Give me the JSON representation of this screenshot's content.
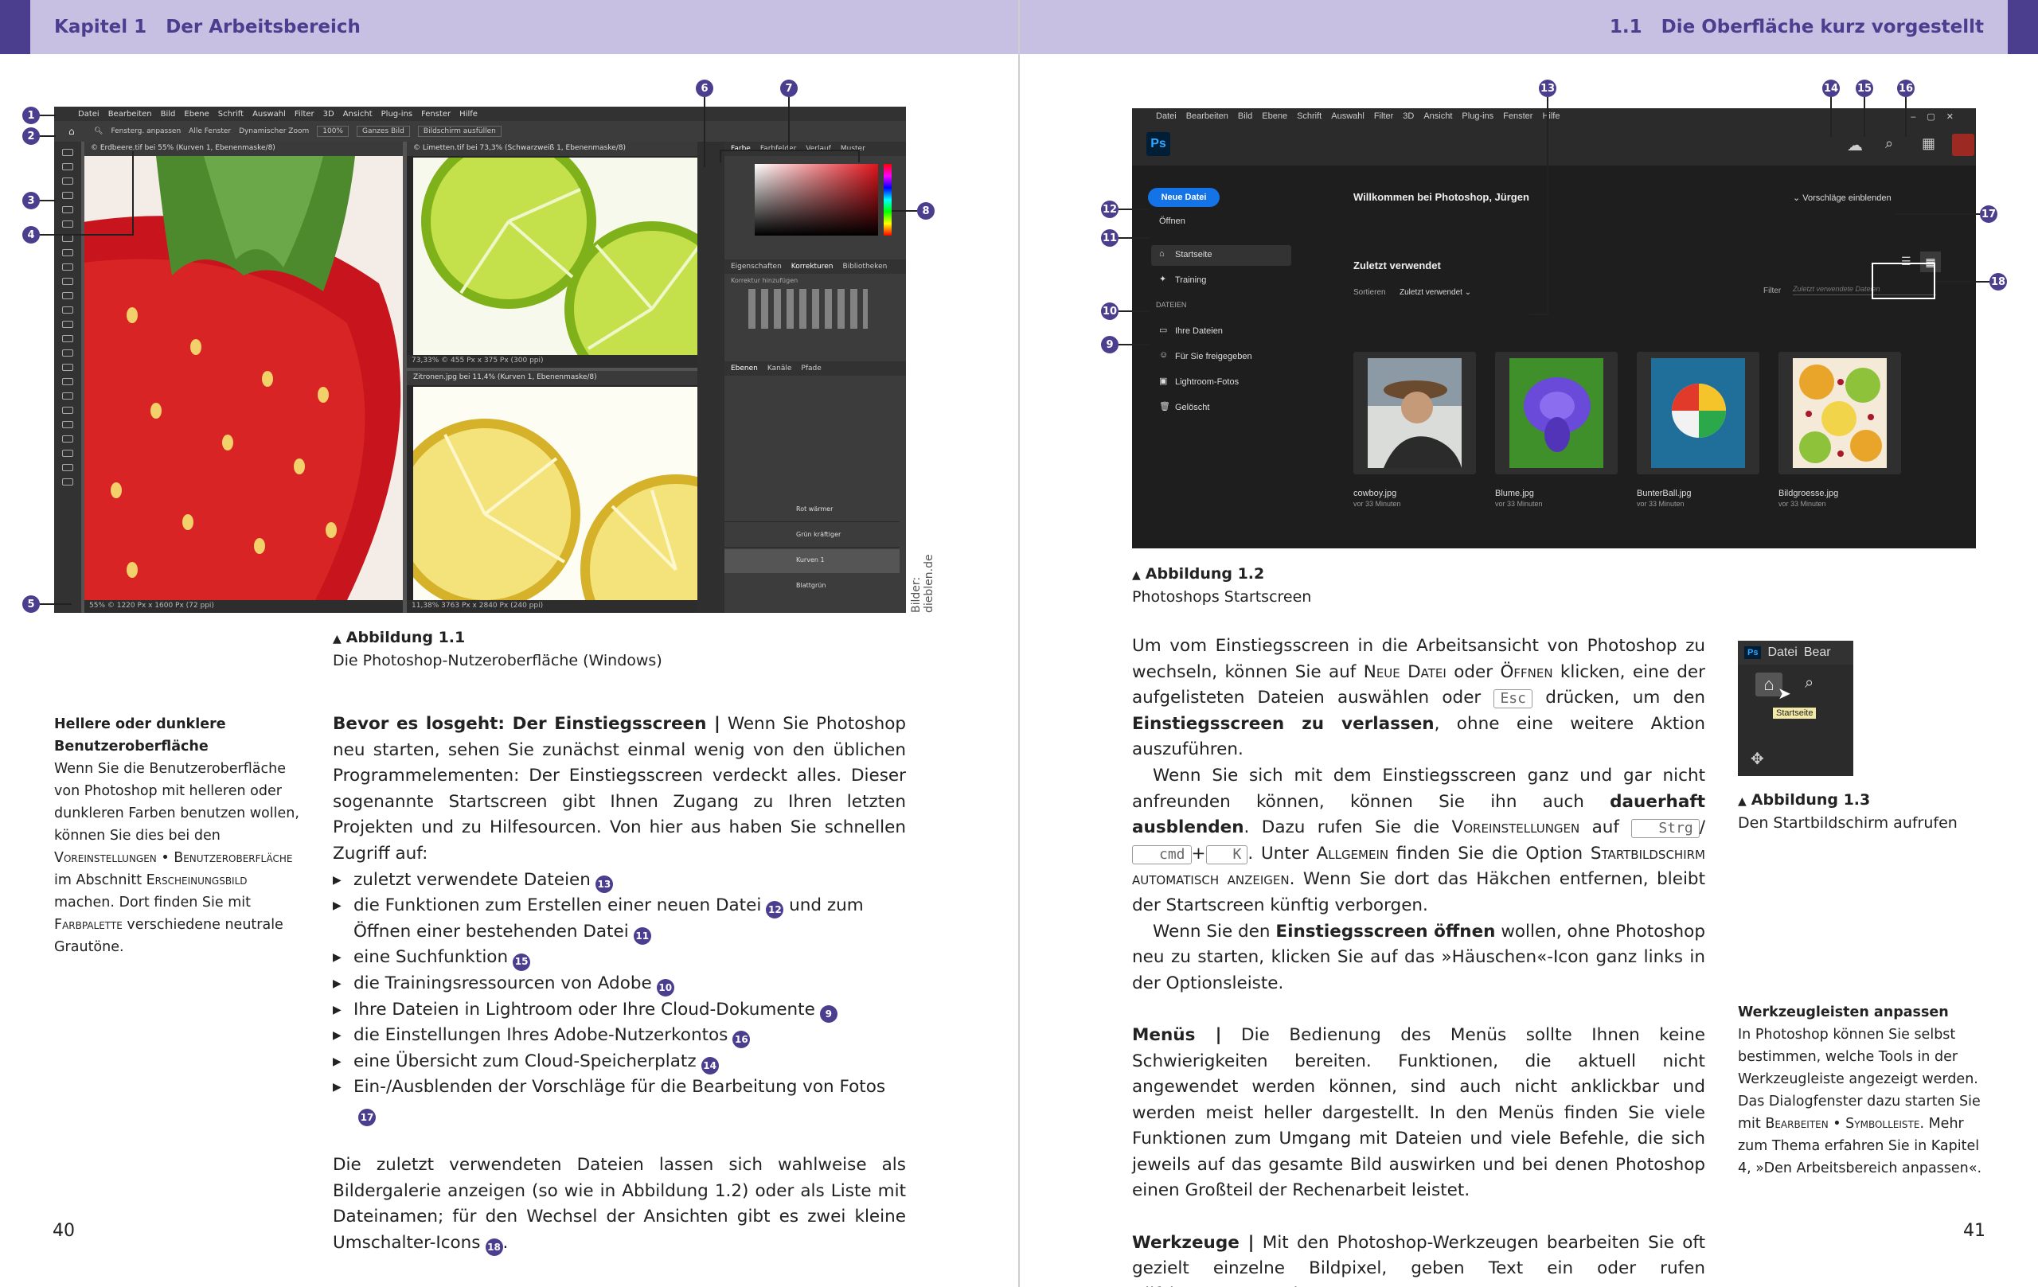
{
  "left": {
    "header_num": "Kapitel 1",
    "header_title": "Der Arbeitsbereich",
    "page_number": "40",
    "figure1": {
      "label": "Abbildung 1.1",
      "caption": "Die Photoshop-Nutzeroberfläche (Windows)",
      "credit": "Bilder: dieblen.de",
      "menu": [
        "Datei",
        "Bearbeiten",
        "Bild",
        "Ebene",
        "Schrift",
        "Auswahl",
        "Filter",
        "3D",
        "Ansicht",
        "Plug-ins",
        "Fenster",
        "Hilfe"
      ],
      "options": [
        "Fensterg. anpassen",
        "Alle Fenster",
        "Dynamischer Zoom",
        "100%",
        "Ganzes Bild",
        "Bildschirm ausfüllen"
      ],
      "doc1_tab": "© Erdbeere.tif bei 55% (Kurven 1, Ebenenmaske/8)",
      "doc1_status": "55%   © 1220 Px x 1600 Px (72 ppi)",
      "doc2_tab": "© Limetten.tif bei 73,3% (Schwarzweiß 1, Ebenenmaske/8)",
      "doc2_status": "73,33%   © 455 Px x 375 Px (300 ppi)",
      "doc3_tab": "Zitronen.jpg bei 11,4% (Kurven 1, Ebenenmaske/8)",
      "doc3_status": "11,38%   3763 Px x 2840 Px (240 ppi)",
      "panel_tabs1": [
        "Farbe",
        "Farbfelder",
        "Verlauf",
        "Muster"
      ],
      "panel_tabs2": [
        "Eigenschaften",
        "Korrekturen",
        "Bibliotheken"
      ],
      "panel_tabs3": [
        "Ebenen",
        "Kanäle",
        "Pfade"
      ],
      "panel_text": "Korrektur hinzufügen",
      "layers": [
        "Rot wärmer",
        "Grün kräftiger",
        "Kurven 1",
        "Blattgrün"
      ],
      "callouts": [
        "1",
        "2",
        "3",
        "4",
        "5",
        "6",
        "7",
        "8"
      ]
    },
    "sidebar": {
      "title": "Hellere oder dunklere Benutzeroberfläche",
      "text_before": "Wenn Sie die Benutzeroberfläche von Photoshop mit helleren oder dunkleren Farben benutzen wollen, können Sie dies bei den ",
      "sc1": "Voreinstellungen • Benutzeroberfläche",
      "text_mid": " im Abschnitt ",
      "sc2": "Erscheinungsbild",
      "text_mid2": " machen. Dort finden Sie mit ",
      "sc3": "Farbpalette",
      "text_after": " verschiedene neutrale Grautöne."
    },
    "body": {
      "lead": "Bevor es losgeht: Der Einstiegsscreen |",
      "intro": " Wenn Sie Photoshop neu starten, sehen Sie zunächst einmal wenig von den üblichen Programmelementen: Der Einstiegsscreen verdeckt alles. Dieser sogenannte Startscreen gibt Ihnen Zugang zu Ihren letzten Projekten und zu Hilfesourcen. Von hier aus haben Sie schnellen Zugriff auf:",
      "bullets": [
        {
          "text": "zuletzt verwendete Dateien",
          "ref": "13"
        },
        {
          "text": "die Funktionen zum Erstellen einer neuen Datei",
          "ref": "12",
          "text2": " und zum Öffnen einer bestehenden Datei",
          "ref2": "11"
        },
        {
          "text": "eine Suchfunktion",
          "ref": "15"
        },
        {
          "text": "die Trainingsressourcen von Adobe",
          "ref": "10"
        },
        {
          "text": "Ihre Dateien in Lightroom oder Ihre Cloud-Dokumente",
          "ref": "9"
        },
        {
          "text": "die Einstellungen Ihres Adobe-Nutzerkontos",
          "ref": "16"
        },
        {
          "text": "eine Übersicht zum Cloud-Speicherplatz",
          "ref": "14"
        },
        {
          "text": "Ein-/Ausblenden der Vorschläge für die Bearbeitung von Fotos",
          "ref": "17"
        }
      ],
      "outro": "Die zuletzt verwendeten Dateien lassen sich wahlweise als Bildergalerie anzeigen (so wie in Abbildung 1.2) oder als Liste mit Dateinamen; für den Wechsel der Ansichten gibt es zwei kleine Umschalter-Icons",
      "outro_ref": "18",
      "outro_end": "."
    }
  },
  "right": {
    "header_num": "1.1",
    "header_title": "Die Oberfläche kurz vorgestellt",
    "page_number": "41",
    "figure2": {
      "label": "Abbildung 1.2",
      "caption": "Photoshops Startscreen",
      "menu": [
        "Datei",
        "Bearbeiten",
        "Bild",
        "Ebene",
        "Schrift",
        "Auswahl",
        "Filter",
        "3D",
        "Ansicht",
        "Plug-ins",
        "Fenster",
        "Hilfe"
      ],
      "logo": "Ps",
      "new_file": "Neue Datei",
      "open": "Öffnen",
      "home": "Startseite",
      "training": "Training",
      "files_heading": "DATEIEN",
      "your_files": "Ihre Dateien",
      "shared": "Für Sie freigegeben",
      "lightroom": "Lightroom-Fotos",
      "deleted": "Gelöscht",
      "welcome": "Willkommen bei Photoshop, Jürgen",
      "suggestions": "Vorschläge einblenden",
      "recent": "Zuletzt verwendet",
      "sort_label": "Sortieren",
      "sort_value": "Zuletzt verwendet",
      "filter_label": "Filter",
      "filter_placeholder": "Zuletzt verwendete Dateien",
      "files": [
        {
          "name": "cowboy.jpg",
          "time": "vor 33 Minuten"
        },
        {
          "name": "Blume.jpg",
          "time": "vor 33 Minuten"
        },
        {
          "name": "BunterBall.jpg",
          "time": "vor 33 Minuten"
        },
        {
          "name": "Bildgroesse.jpg",
          "time": "vor 33 Minuten"
        }
      ],
      "callouts": [
        "9",
        "10",
        "11",
        "12",
        "13",
        "14",
        "15",
        "16",
        "17",
        "18"
      ]
    },
    "figure3": {
      "label": "Abbildung 1.3",
      "caption": "Den Startbildschirm aufrufen",
      "logo": "Ps",
      "menu1": "Datei",
      "menu2": "Bear",
      "tooltip": "Startseite"
    },
    "body1": {
      "p1a": "Um vom Einstiegsscreen in die Arbeitsansicht von Photoshop zu wechseln, können Sie auf ",
      "p1sc1": "Neue Datei",
      "p1b": " oder ",
      "p1sc2": "Öffnen",
      "p1c": " klicken, eine der aufgelisteten Dateien auswählen oder ",
      "p1key": "Esc",
      "p1d": " drücken, um den ",
      "p1bold": "Einstiegsscreen zu verlassen",
      "p1e": ", ohne eine weitere Aktion auszuführen.",
      "p2a": "Wenn Sie sich mit dem Einstiegsscreen ganz und gar nicht anfreunden können, können Sie ihn auch ",
      "p2bold": "dauerhaft ausblenden",
      "p2b": ". Dazu rufen Sie die ",
      "p2sc1": "Voreinstellungen",
      "p2c": " auf ",
      "key1": "Strg",
      "slash": "/",
      "key2": "cmd",
      "plus": "+",
      "key3": "K",
      "p2d": ". Unter ",
      "p2sc2": "Allgemein",
      "p2e": " finden Sie die Option ",
      "p2sc3": "Startbildschirm automatisch anzeigen",
      "p2f": ". Wenn Sie dort das Häkchen entfernen, bleibt der Startscreen künftig verborgen.",
      "p3a": "Wenn Sie den ",
      "p3bold": "Einstiegsscreen öffnen",
      "p3b": " wollen, ohne Photoshop neu zu starten, klicken Sie auf das »Häuschen«-Icon ganz links in der Optionsleiste."
    },
    "body2": {
      "lead": "Menüs |",
      "text": " Die Bedienung des Menüs sollte Ihnen keine Schwierigkeiten bereiten. Funktionen, die aktuell nicht angewendet werden können, sind auch nicht anklickbar und werden meist heller dargestellt. In den Menüs finden Sie viele Funktionen zum Umgang mit Dateien und viele Befehle, die sich jeweils auf das gesamte Bild auswirken und bei denen Photoshop einen Großteil der Rechenarbeit leistet."
    },
    "body3": {
      "lead": "Werkzeuge |",
      "text": " Mit den Photoshop-Werkzeugen bearbeiten Sie oft gezielt einzelne Bildpixel, geben Text ein oder rufen Hilfsinstrumente wie"
    },
    "sidebar": {
      "title": "Werkzeugleisten anpassen",
      "text_before": "In Photoshop können Sie selbst bestimmen, welche Tools in der Werkzeugleiste angezeigt werden. Das Dialogfenster dazu starten Sie mit ",
      "sc1": "Bearbeiten • Symbolleiste",
      "text_after": ". Mehr zum Thema erfahren Sie in Kapitel 4, »Den Arbeitsbereich anpassen«."
    }
  }
}
